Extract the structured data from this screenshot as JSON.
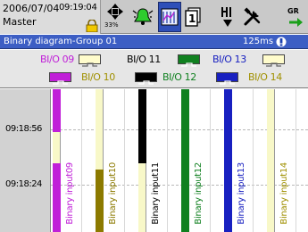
{
  "status": {
    "date": "2006/07/04",
    "time": "09:19:04",
    "user": "Master"
  },
  "toolbar": {
    "navi_label": "33%",
    "group_label": "GR"
  },
  "title_bar": {
    "title": "Binary diagram-Group 01",
    "rate": "125ms"
  },
  "legend": {
    "items": [
      {
        "label": "BI/O 09",
        "color": "#c020d8"
      },
      {
        "label": "BI/O 10",
        "color": "#a09000"
      },
      {
        "label": "BI/O 11",
        "color": "#000000"
      },
      {
        "label": "BI/O 12",
        "color": "#108020"
      },
      {
        "label": "BI/O 13",
        "color": "#1820c0"
      },
      {
        "label": "BI/O 14",
        "color": "#a09000"
      }
    ]
  },
  "chart": {
    "time_labels": [
      "09:18:56",
      "09:18:24"
    ],
    "channels": [
      {
        "name": "Binary input09",
        "color": "#c020d8",
        "on_segments": [
          [
            0.0,
            0.3
          ],
          [
            0.52,
            1.0
          ]
        ]
      },
      {
        "name": "Binary input10",
        "color": "#8c7a00",
        "on_segments": [
          [
            0.56,
            1.0
          ]
        ]
      },
      {
        "name": "Binary input11",
        "color": "#000000",
        "on_segments": [
          [
            0.0,
            0.52
          ]
        ]
      },
      {
        "name": "Binary input12",
        "color": "#108020",
        "on_segments": [
          [
            0.0,
            1.0
          ]
        ]
      },
      {
        "name": "Binary input13",
        "color": "#1820c0",
        "on_segments": [
          [
            0.0,
            1.0
          ]
        ]
      },
      {
        "name": "Binary input14",
        "color": "#a09000",
        "on_segments": []
      }
    ]
  }
}
